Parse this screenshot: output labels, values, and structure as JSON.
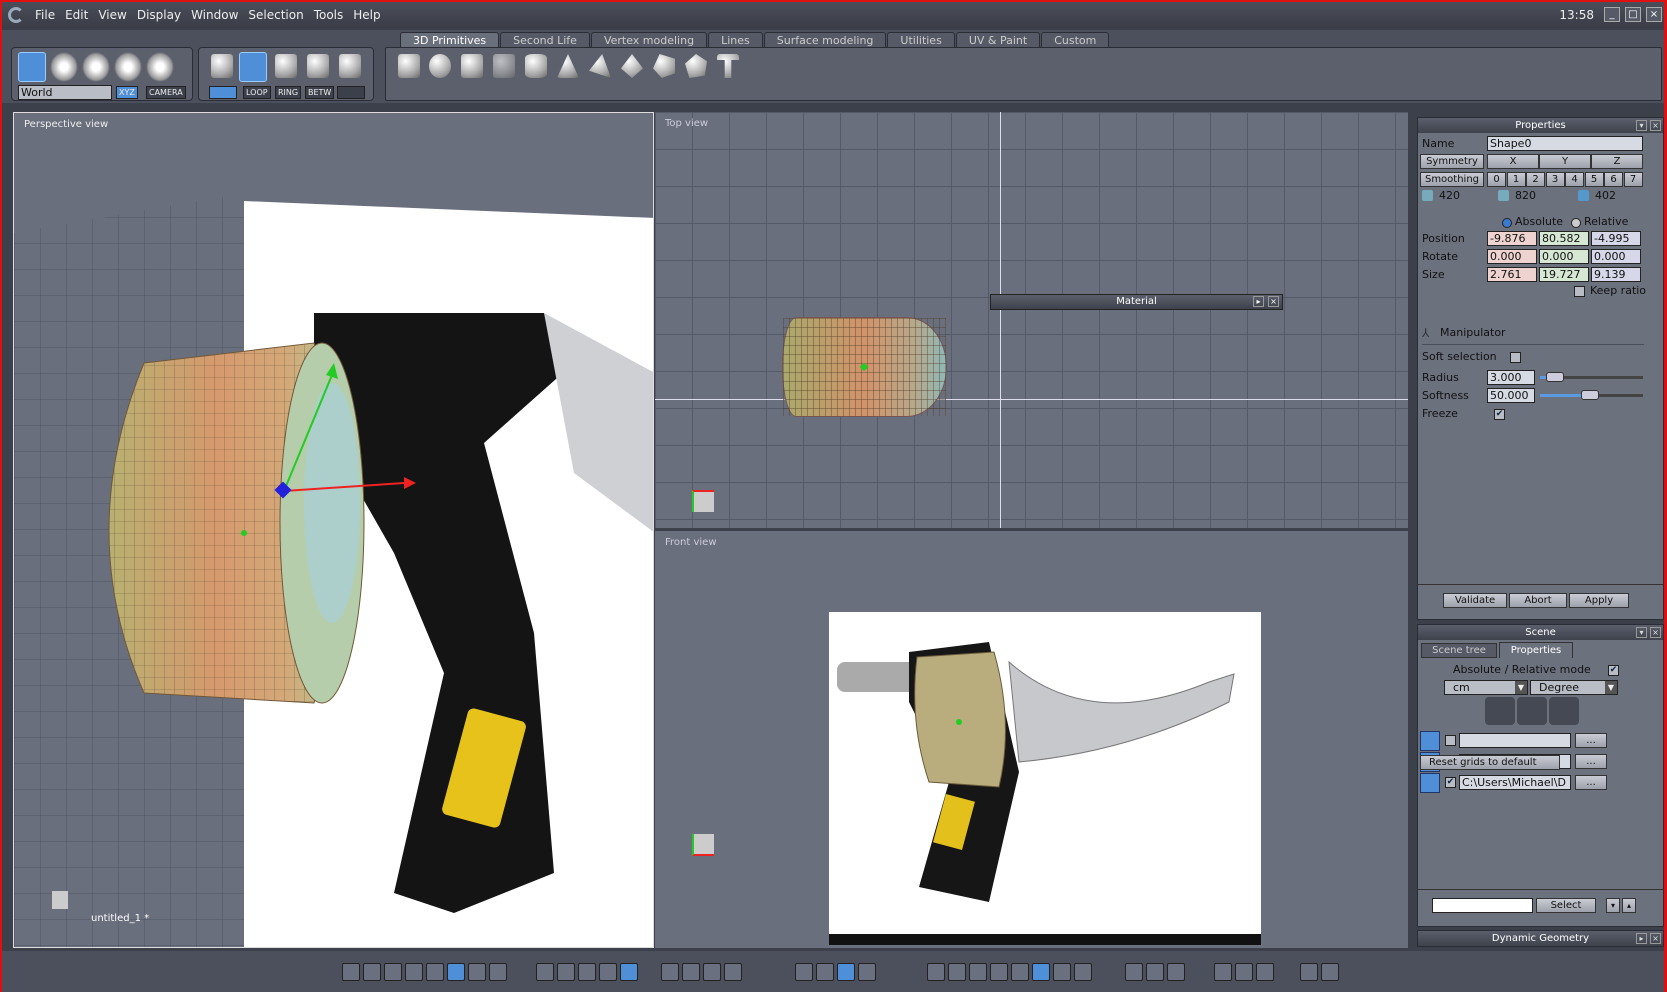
{
  "menu": [
    "File",
    "Edit",
    "View",
    "Display",
    "Window",
    "Selection",
    "Tools",
    "Help"
  ],
  "clock": "13:58",
  "window_controls": [
    "_",
    "□",
    "×"
  ],
  "toolbar": {
    "tabs": [
      "3D Primitives",
      "Second Life",
      "Vertex modeling",
      "Lines",
      "Surface modeling",
      "Utilities",
      "UV & Paint",
      "Custom"
    ],
    "active_tab": "3D Primitives",
    "space_select": "World",
    "mode_buttons": [
      "XYZ",
      "CAMERA"
    ],
    "selection_buttons": [
      "LOOP",
      "RING",
      "BETW"
    ]
  },
  "viewports": {
    "perspective": "Perspective view",
    "top": "Top view",
    "front": "Front view",
    "file_label": "untitled_1 *"
  },
  "material_panel": {
    "title": "Material"
  },
  "properties": {
    "title": "Properties",
    "name_label": "Name",
    "name_value": "Shape0",
    "symmetry_label": "Symmetry",
    "symmetry_axes": [
      "X",
      "Y",
      "Z"
    ],
    "smoothing_label": "Smoothing",
    "smoothing_levels": [
      "0",
      "1",
      "2",
      "3",
      "4",
      "5",
      "6",
      "7"
    ],
    "counts": [
      "420",
      "820",
      "402"
    ],
    "absolute_label": "Absolute",
    "relative_label": "Relative",
    "mode": "Absolute",
    "position_label": "Position",
    "position": [
      "-9.876",
      "80.582",
      "-4.995"
    ],
    "rotate_label": "Rotate",
    "rotate": [
      "0.000",
      "0.000",
      "0.000"
    ],
    "size_label": "Size",
    "size": [
      "2.761",
      "19.727",
      "9.139"
    ],
    "keep_ratio_label": "Keep ratio",
    "keep_ratio": false,
    "manipulator_label": "Manipulator",
    "soft_selection_label": "Soft selection",
    "soft_selection": false,
    "radius_label": "Radius",
    "radius": "3.000",
    "softness_label": "Softness",
    "softness": "50.000",
    "freeze_label": "Freeze",
    "freeze": true,
    "validate": "Validate",
    "abort": "Abort",
    "apply": "Apply"
  },
  "scene": {
    "title": "Scene",
    "tabs": [
      "Scene tree",
      "Properties"
    ],
    "active_tab": "Properties",
    "abs_rel_label": "Absolute / Relative mode",
    "abs_rel": true,
    "unit": "cm",
    "angle_unit": "Degree",
    "grids": [
      {
        "checked": false,
        "path": ""
      },
      {
        "checked": false,
        "path": ""
      },
      {
        "checked": true,
        "path": "C:\\Users\\Michael\\D"
      }
    ],
    "browse": "...",
    "reset_grids": "Reset grids to default",
    "select_button": "Select",
    "select_value": ""
  },
  "dynamic_geometry": {
    "title": "Dynamic Geometry"
  },
  "colors": {
    "accent": "#4f8fd8",
    "frame": "#e01010",
    "viewport": "#6a6f7d"
  }
}
